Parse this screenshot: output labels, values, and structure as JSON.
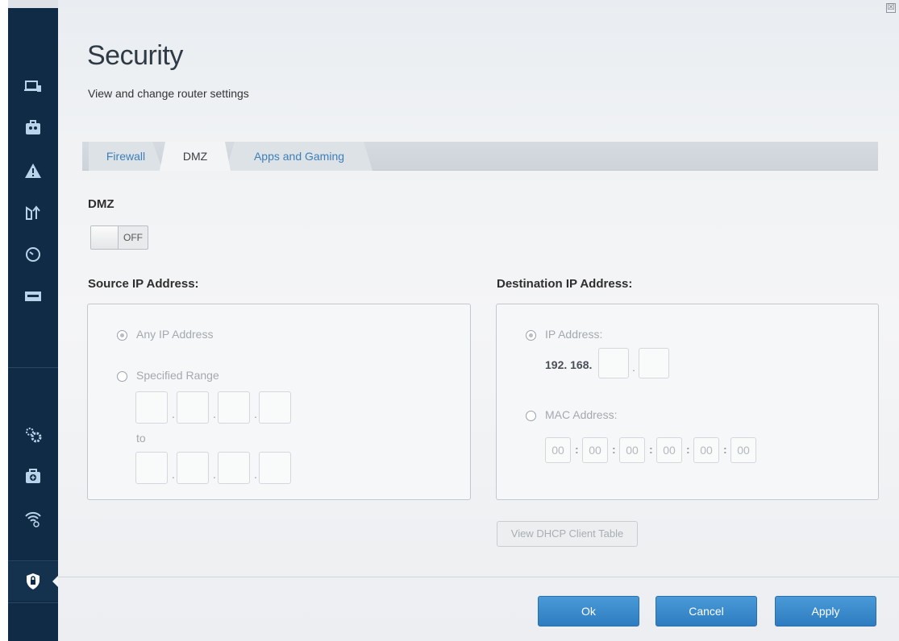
{
  "page": {
    "title": "Security",
    "subtitle": "View and change router settings",
    "close_glyph": "☒"
  },
  "sidebar": {
    "items": [
      {
        "icon": "device-list-icon"
      },
      {
        "icon": "parental-controls-icon"
      },
      {
        "icon": "alert-icon"
      },
      {
        "icon": "media-prioritization-icon"
      },
      {
        "icon": "speed-test-icon"
      },
      {
        "icon": "external-storage-icon"
      },
      {
        "icon": "connectivity-gear-icon"
      },
      {
        "icon": "troubleshooting-icon"
      },
      {
        "icon": "wireless-icon"
      },
      {
        "icon": "security-lock-icon",
        "active": true
      }
    ]
  },
  "tabs": [
    {
      "label": "Firewall"
    },
    {
      "label": "DMZ",
      "active": true
    },
    {
      "label": "Apps and Gaming"
    }
  ],
  "dmz": {
    "heading": "DMZ",
    "toggle_label": "OFF"
  },
  "source": {
    "heading": "Source IP Address:",
    "any_label": "Any IP Address",
    "range_label": "Specified Range",
    "to_label": "to",
    "dot": "."
  },
  "destination": {
    "heading": "Destination IP Address:",
    "ip_label": "IP Address:",
    "ip_prefix": "192. 168.",
    "dot": ".",
    "mac_label": "MAC Address:",
    "mac_values": [
      "00",
      "00",
      "00",
      "00",
      "00",
      "00"
    ],
    "colon": ":"
  },
  "buttons": {
    "dhcp": "View DHCP Client Table",
    "ok": "Ok",
    "cancel": "Cancel",
    "apply": "Apply"
  },
  "colors": {
    "sidebar_bg": "#0f2b45",
    "accent_blue": "#2d7cc0",
    "tab_link": "#3d7fb8"
  }
}
